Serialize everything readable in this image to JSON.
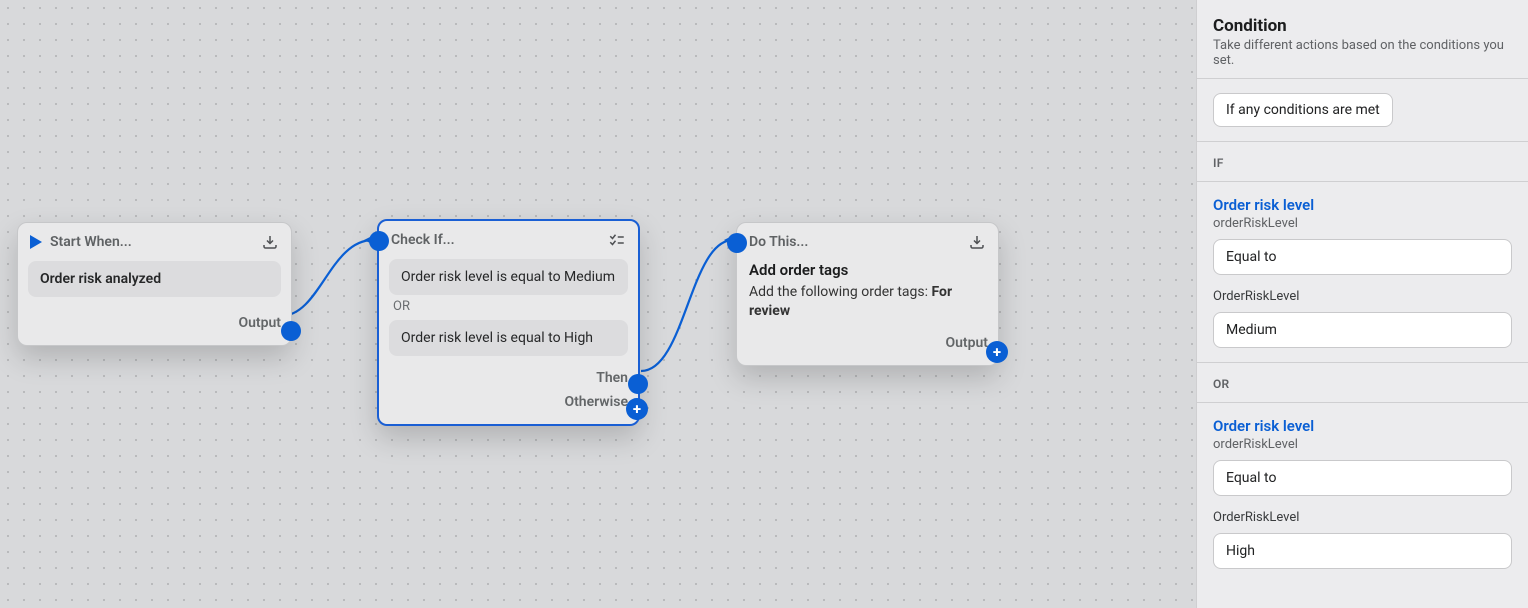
{
  "canvas": {
    "start": {
      "header": "Start When...",
      "trigger": "Order risk analyzed",
      "output_label": "Output"
    },
    "condition": {
      "header": "Check If...",
      "cond1": "Order risk level is equal to Medium",
      "or": "OR",
      "cond2": "Order risk level is equal to High",
      "then_label": "Then",
      "otherwise_label": "Otherwise"
    },
    "action": {
      "header": "Do This...",
      "title": "Add order tags",
      "desc_prefix": "Add the following order tags: ",
      "desc_bold": "For review",
      "output_label": "Output"
    }
  },
  "panel": {
    "title": "Condition",
    "subtitle": "Take different actions based on the conditions you set.",
    "mode_tag": "If any conditions are met",
    "groups": [
      {
        "connector": "IF",
        "link": "Order risk level",
        "sub": "orderRiskLevel",
        "operator": "Equal to",
        "field_label": "OrderRiskLevel",
        "value": "Medium"
      },
      {
        "connector": "OR",
        "link": "Order risk level",
        "sub": "orderRiskLevel",
        "operator": "Equal to",
        "field_label": "OrderRiskLevel",
        "value": "High"
      }
    ]
  }
}
